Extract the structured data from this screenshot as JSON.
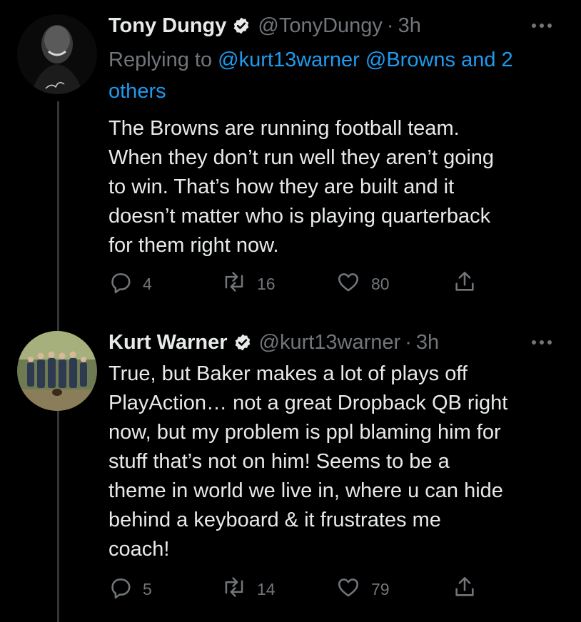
{
  "colors": {
    "background": "#000000",
    "text_primary": "#e7e9ea",
    "text_secondary": "#71767b",
    "accent": "#1d9bf0",
    "thread_line": "#333639"
  },
  "tweets": [
    {
      "name": "Tony Dungy",
      "verified": true,
      "handle": "@TonyDungy",
      "separator": "·",
      "time": "3h",
      "avatar_icon": "profile-photo-tony-dungy",
      "reply_to": {
        "prefix": "Replying to",
        "mentions_line1": "@kurt13warner @Browns and 2",
        "mentions_line2": "others"
      },
      "lines": [
        "The Browns are running football team.",
        "When they don’t run well they aren’t going",
        "to win. That’s how they are built and it",
        "doesn’t matter who is playing quarterback",
        "for them right now."
      ],
      "actions": {
        "replies": "4",
        "retweets": "16",
        "likes": "80"
      }
    },
    {
      "name": "Kurt Warner",
      "verified": true,
      "handle": "@kurt13warner",
      "separator": "·",
      "time": "3h",
      "avatar_icon": "profile-photo-family-group",
      "lines": [
        "True, but Baker makes a lot of plays off",
        "PlayAction… not a great Dropback QB right",
        "now, but my problem is ppl blaming him for",
        "stuff that’s not on him! Seems to be a",
        "theme in world we live in,  where u can hide",
        "behind a keyboard & it frustrates me",
        "coach!"
      ],
      "actions": {
        "replies": "5",
        "retweets": "14",
        "likes": "79"
      }
    }
  ]
}
